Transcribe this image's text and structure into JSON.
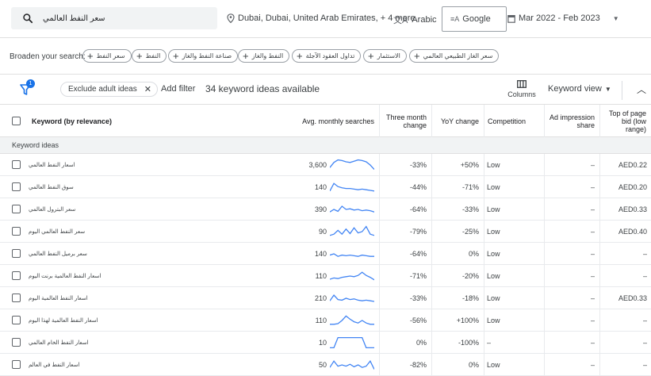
{
  "search": {
    "query": "سعر النفط العالمي"
  },
  "filters": {
    "location": "Dubai, Dubai, United Arab Emirates, + 4 more",
    "language": "Arabic",
    "network": "Google",
    "date_range": "Mar 2022 - Feb 2023"
  },
  "broaden": {
    "label": "Broaden your search:",
    "chips": [
      "سعر النفط",
      "النفط",
      "صناعة النفط والغاز",
      "النفط والغاز",
      "تداول العقود الآجلة",
      "الاستثمار",
      "سعر الغاز الطبيعي العالمي"
    ]
  },
  "toolbar": {
    "filter_count": "1",
    "adult_chip": "Exclude adult ideas",
    "add_filter": "Add filter",
    "ideas_count": "34 keyword ideas available",
    "columns": "Columns",
    "keyword_view": "Keyword view"
  },
  "table": {
    "headers": {
      "keyword": "Keyword (by relevance)",
      "searches": "Avg. monthly searches",
      "three_month": "Three month change",
      "yoy": "YoY change",
      "competition": "Competition",
      "impression": "Ad impression share",
      "bid": "Top of page bid (low range)"
    },
    "group_label": "Keyword ideas",
    "rows": [
      {
        "keyword": "اسعار النفط العالمي",
        "searches": "3,600",
        "three_month": "-33%",
        "yoy": "+50%",
        "competition": "Low",
        "impression": "–",
        "bid": "AED0.22",
        "trend": [
          0.3,
          0.7,
          0.9,
          0.85,
          0.75,
          0.7,
          0.8,
          0.9,
          0.85,
          0.75,
          0.5,
          0.15
        ]
      },
      {
        "keyword": "سوق النفط العالمي",
        "searches": "140",
        "three_month": "-44%",
        "yoy": "-71%",
        "competition": "Low",
        "impression": "–",
        "bid": "AED0.20",
        "trend": [
          0.2,
          0.8,
          0.55,
          0.45,
          0.4,
          0.4,
          0.35,
          0.3,
          0.35,
          0.3,
          0.25,
          0.2
        ]
      },
      {
        "keyword": "سعر البترول العالمي",
        "searches": "390",
        "three_month": "-64%",
        "yoy": "-33%",
        "competition": "Low",
        "impression": "–",
        "bid": "AED0.33",
        "trend": [
          0.3,
          0.5,
          0.35,
          0.75,
          0.5,
          0.55,
          0.45,
          0.5,
          0.4,
          0.45,
          0.4,
          0.3
        ]
      },
      {
        "keyword": "سعر النفط العالمي اليوم",
        "searches": "90",
        "three_month": "-79%",
        "yoy": "-25%",
        "competition": "Low",
        "impression": "–",
        "bid": "AED0.40",
        "trend": [
          0.2,
          0.3,
          0.6,
          0.3,
          0.7,
          0.35,
          0.8,
          0.4,
          0.5,
          0.9,
          0.3,
          0.2
        ]
      },
      {
        "keyword": "سعر برميل النفط العالمي",
        "searches": "140",
        "three_month": "-64%",
        "yoy": "0%",
        "competition": "Low",
        "impression": "–",
        "bid": "–",
        "trend": [
          0.4,
          0.5,
          0.3,
          0.4,
          0.35,
          0.4,
          0.35,
          0.3,
          0.4,
          0.35,
          0.3,
          0.3
        ]
      },
      {
        "keyword": "اسعار النفط العالمية برنت اليوم",
        "searches": "110",
        "three_month": "-71%",
        "yoy": "-20%",
        "competition": "Low",
        "impression": "–",
        "bid": "–",
        "trend": [
          0.25,
          0.35,
          0.3,
          0.4,
          0.45,
          0.5,
          0.45,
          0.55,
          0.8,
          0.55,
          0.4,
          0.2
        ]
      },
      {
        "keyword": "اسعار النفط العالمية اليوم",
        "searches": "210",
        "three_month": "-33%",
        "yoy": "-18%",
        "competition": "Low",
        "impression": "–",
        "bid": "AED0.33",
        "trend": [
          0.3,
          0.75,
          0.4,
          0.35,
          0.5,
          0.4,
          0.45,
          0.35,
          0.3,
          0.35,
          0.3,
          0.25
        ]
      },
      {
        "keyword": "اسعار النفط العالمية لهذا اليوم",
        "searches": "110",
        "three_month": "-56%",
        "yoy": "+100%",
        "competition": "Low",
        "impression": "–",
        "bid": "–",
        "trend": [
          0.2,
          0.2,
          0.25,
          0.5,
          0.85,
          0.6,
          0.4,
          0.3,
          0.5,
          0.3,
          0.2,
          0.2
        ]
      },
      {
        "keyword": "اسعار النفط الخام العالمي",
        "searches": "10",
        "three_month": "0%",
        "yoy": "-100%",
        "competition": "–",
        "impression": "–",
        "bid": "–",
        "trend": [
          0.1,
          0.1,
          0.9,
          0.9,
          0.9,
          0.9,
          0.9,
          0.9,
          0.9,
          0.1,
          0.1,
          0.1
        ]
      },
      {
        "keyword": "اسعار النفط في العالم",
        "searches": "50",
        "three_month": "-82%",
        "yoy": "0%",
        "competition": "Low",
        "impression": "–",
        "bid": "–",
        "trend": [
          0.3,
          0.8,
          0.4,
          0.5,
          0.4,
          0.55,
          0.35,
          0.5,
          0.3,
          0.4,
          0.8,
          0.15
        ]
      }
    ]
  },
  "colors": {
    "accent": "#1a73e8",
    "spark": "#4285f4",
    "group_bg": "#f1f3f4"
  },
  "icons": [
    "search-icon",
    "location-pin-icon",
    "translate-icon",
    "network-icon",
    "calendar-icon",
    "filter-funnel-icon",
    "columns-icon",
    "chevron-up-icon"
  ]
}
